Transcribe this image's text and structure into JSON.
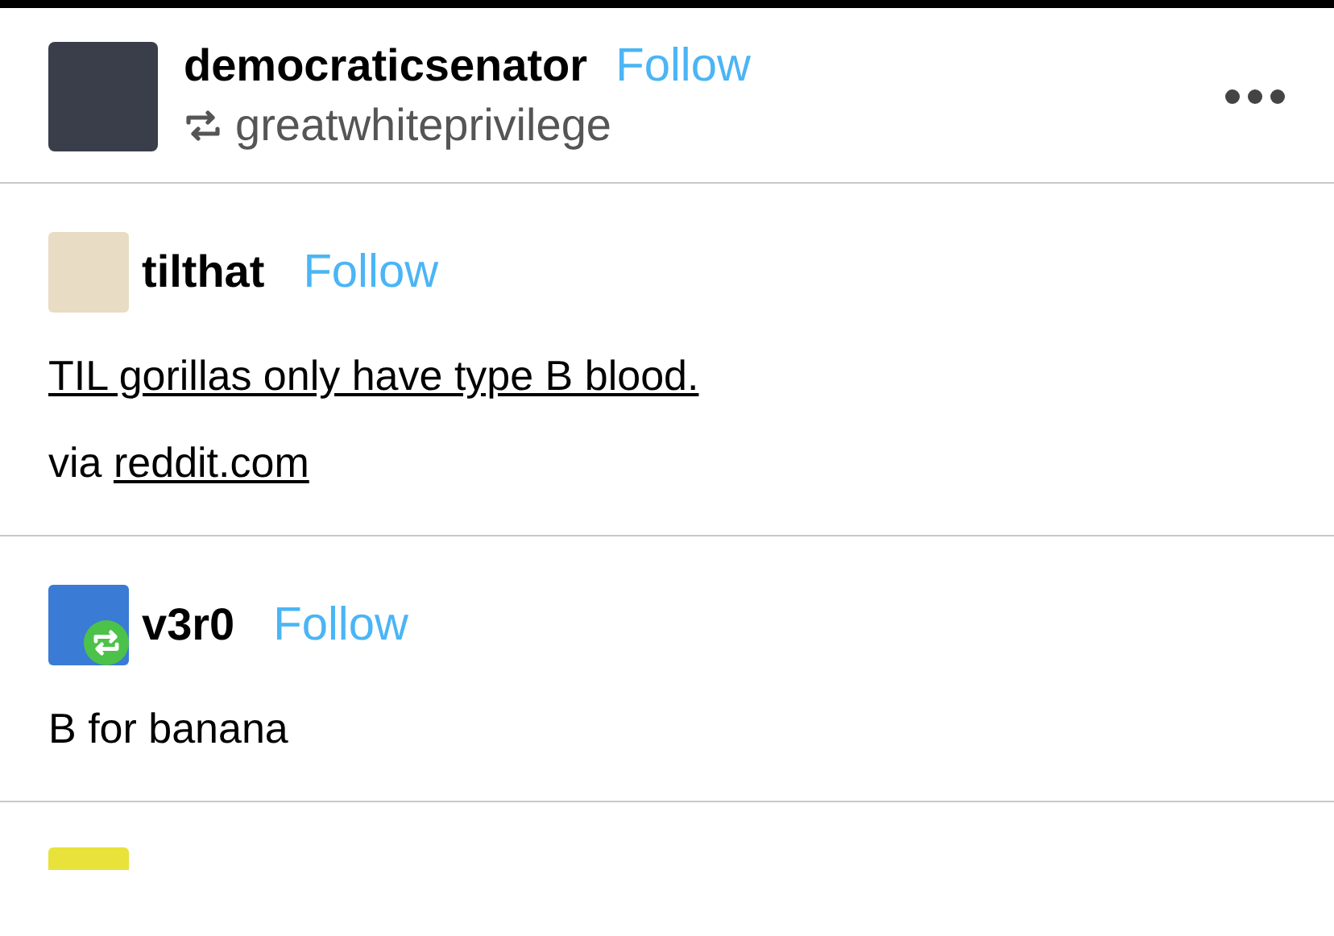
{
  "post": {
    "author": "democraticsenator",
    "follow": "Follow",
    "reblogged_from": "greatwhiteprivilege"
  },
  "thread": [
    {
      "name": "tilthat",
      "follow": "Follow",
      "reblog_badge": false,
      "content": [
        {
          "kind": "link",
          "text": "TIL gorillas only have type B blood."
        },
        {
          "kind": "via",
          "prefix": "via",
          "link": "reddit.com"
        }
      ]
    },
    {
      "name": "v3r0",
      "follow": "Follow",
      "reblog_badge": true,
      "content": [
        {
          "kind": "text",
          "text": "B for banana"
        }
      ]
    }
  ]
}
